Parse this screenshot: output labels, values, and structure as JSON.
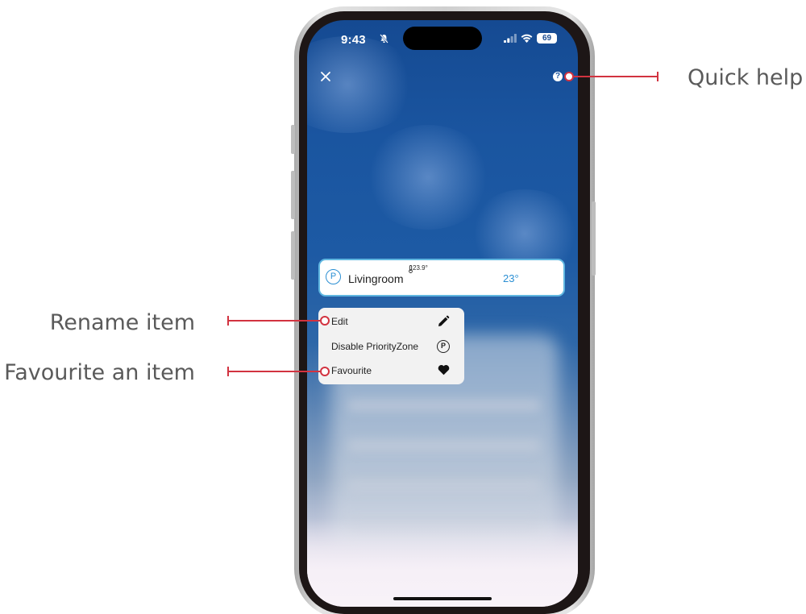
{
  "status_bar": {
    "time": "9:43",
    "battery": "69"
  },
  "room": {
    "name": "Livingroom",
    "sensor_temp": "23.9°",
    "setpoint": "23°",
    "badge": "P"
  },
  "context_menu": {
    "items": [
      {
        "label": "Edit",
        "icon": "pencil-icon"
      },
      {
        "label": "Disable PriorityZone",
        "icon": "priority-zone-icon",
        "icon_text": "P"
      },
      {
        "label": "Favourite",
        "icon": "heart-icon"
      }
    ]
  },
  "help_icon_glyph": "?",
  "callouts": {
    "quick_help": "Quick help",
    "rename_item": "Rename item",
    "favourite_item": "Favourite an item"
  },
  "colors": {
    "callout": "#d23340",
    "accent": "#2b8fd3",
    "card_border": "#5fb6e0",
    "screen_bg": "#1a55a0"
  }
}
